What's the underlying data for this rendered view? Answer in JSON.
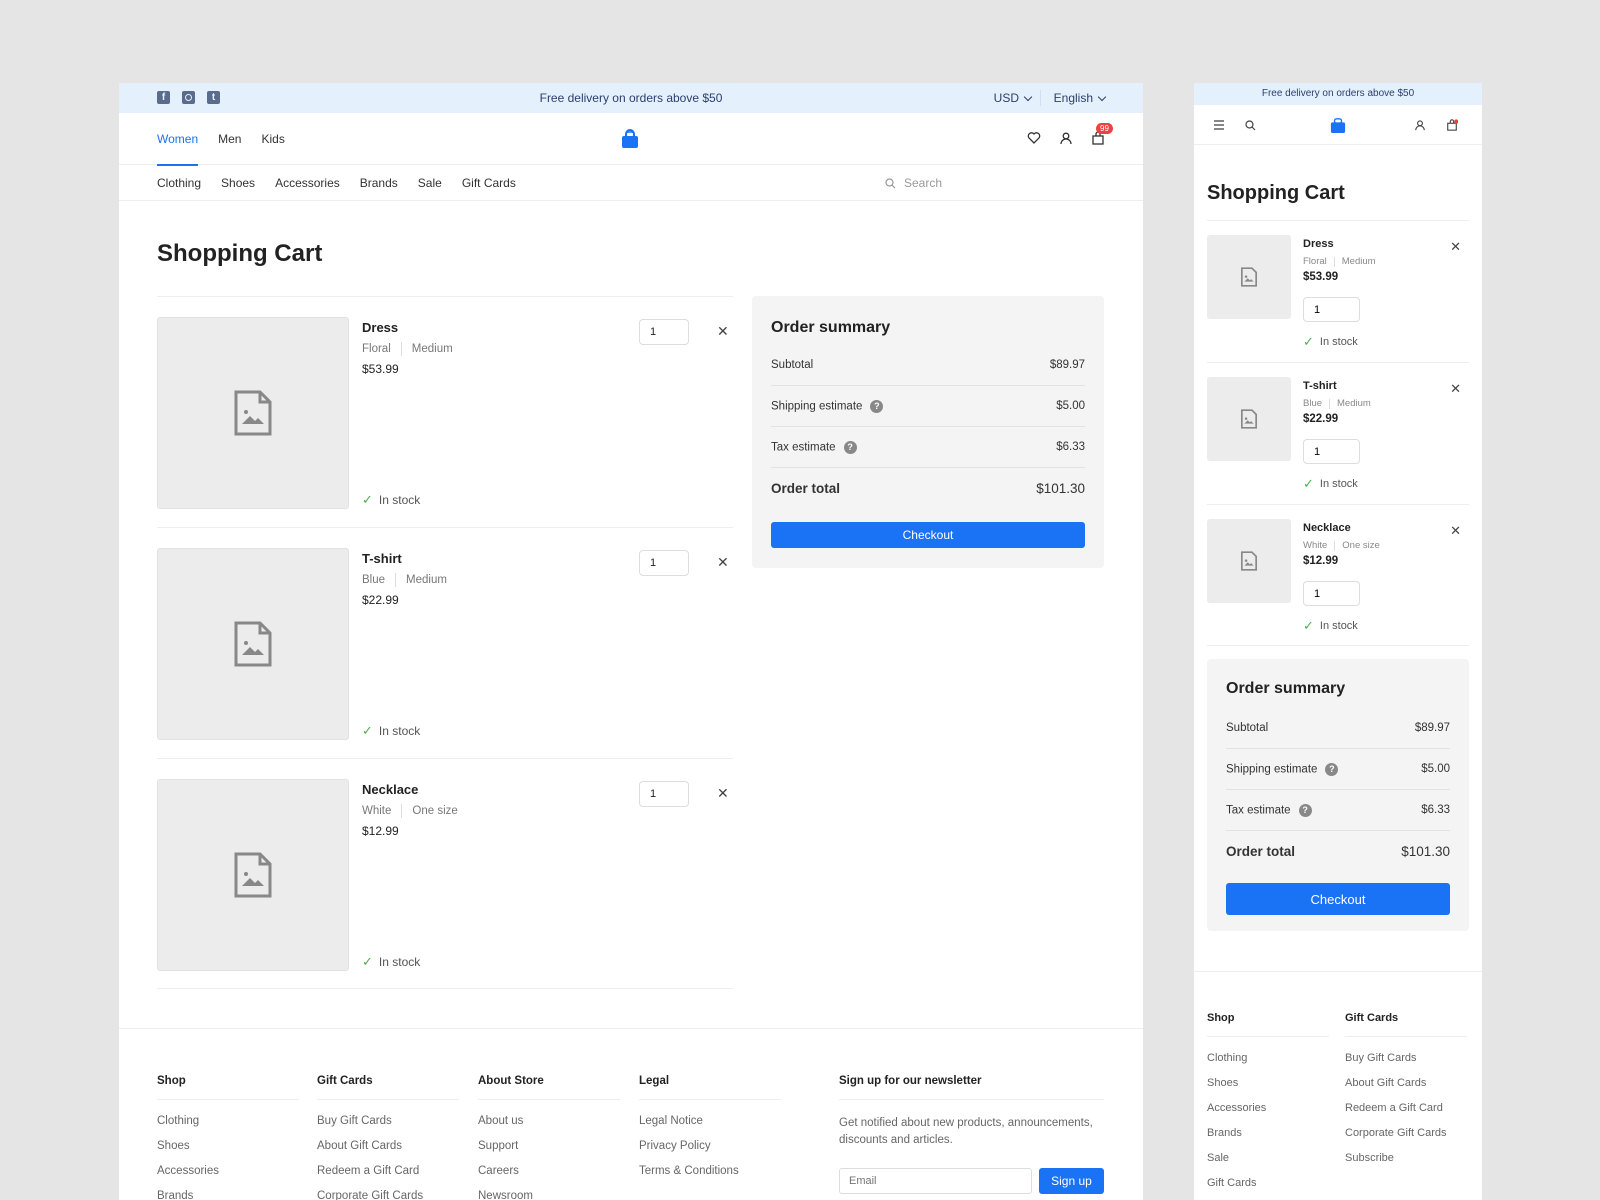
{
  "promo_text": "Free delivery on orders above $50",
  "currency": "USD",
  "language": "English",
  "social": [
    "facebook",
    "instagram",
    "twitter"
  ],
  "main_categories": [
    {
      "label": "Women",
      "active": true
    },
    {
      "label": "Men",
      "active": false
    },
    {
      "label": "Kids",
      "active": false
    }
  ],
  "sub_categories": [
    "Clothing",
    "Shoes",
    "Accessories",
    "Brands",
    "Sale",
    "Gift Cards"
  ],
  "search_placeholder": "Search",
  "cart_badge": "99",
  "page_title": "Shopping Cart",
  "cart_items": [
    {
      "name": "Dress",
      "color": "Floral",
      "size": "Medium",
      "price": "$53.99",
      "quantity": "1",
      "stock": "In stock"
    },
    {
      "name": "T-shirt",
      "color": "Blue",
      "size": "Medium",
      "price": "$22.99",
      "quantity": "1",
      "stock": "In stock"
    },
    {
      "name": "Necklace",
      "color": "White",
      "size": "One size",
      "price": "$12.99",
      "quantity": "1",
      "stock": "In stock"
    }
  ],
  "summary": {
    "title": "Order summary",
    "subtotal_label": "Subtotal",
    "subtotal": "$89.97",
    "shipping_label": "Shipping estimate",
    "shipping": "$5.00",
    "tax_label": "Tax estimate",
    "tax": "$6.33",
    "total_label": "Order total",
    "total": "$101.30",
    "checkout_label": "Checkout"
  },
  "footer": {
    "columns": [
      {
        "title": "Shop",
        "links": [
          "Clothing",
          "Shoes",
          "Accessories",
          "Brands",
          "Sale",
          "Gift Cards"
        ]
      },
      {
        "title": "Gift Cards",
        "links": [
          "Buy Gift Cards",
          "About Gift Cards",
          "Redeem a Gift Card",
          "Corporate Gift Cards",
          "Subscribe"
        ]
      },
      {
        "title": "About Store",
        "links": [
          "About us",
          "Support",
          "Careers",
          "Newsroom"
        ]
      },
      {
        "title": "Legal",
        "links": [
          "Legal Notice",
          "Privacy Policy",
          "Terms & Conditions"
        ]
      }
    ],
    "newsletter": {
      "title": "Sign up for our newsletter",
      "text": "Get notified about new products, announcements, discounts and articles.",
      "email_placeholder": "Email",
      "button_label": "Sign up"
    }
  },
  "colors": {
    "accent": "#1a73f5",
    "promo_bg": "#e4f1fd",
    "in_stock": "#4caf50",
    "badge": "#f04040"
  }
}
